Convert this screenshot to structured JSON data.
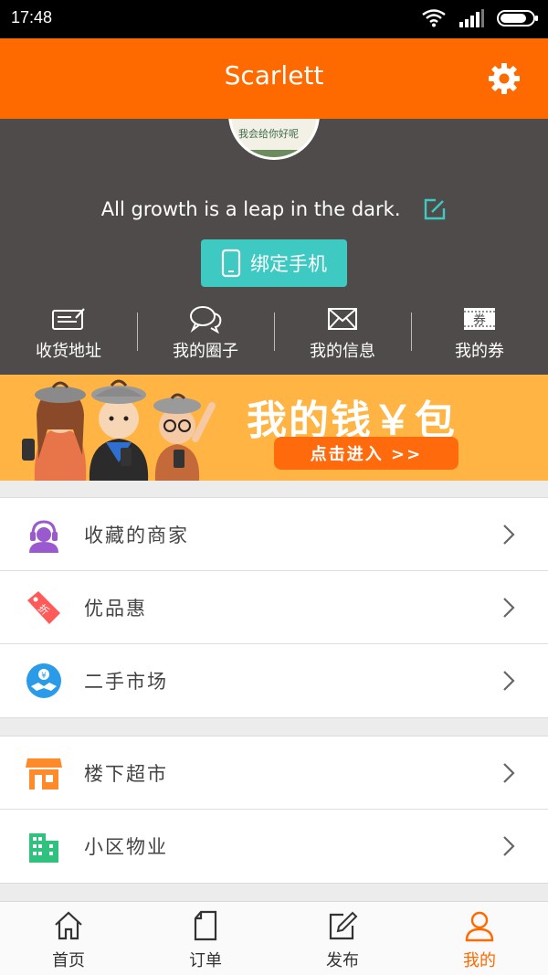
{
  "status_bar": {
    "time": "17:48"
  },
  "header": {
    "title": "Scarlett"
  },
  "profile": {
    "avatar_scribble": "我会给你好呢",
    "motto": "All growth is a leap in the dark.",
    "bind_phone_label": "绑定手机",
    "quick_links": [
      {
        "label": "收货地址",
        "icon": "address-card-icon"
      },
      {
        "label": "我的圈子",
        "icon": "chat-bubbles-icon"
      },
      {
        "label": "我的信息",
        "icon": "envelope-icon"
      },
      {
        "label": "我的券",
        "icon": "coupon-icon"
      }
    ],
    "coupon_icon_text": "券"
  },
  "wallet_banner": {
    "title": "我的钱￥包",
    "button_label": "点击进入 >>"
  },
  "menu_groups": [
    [
      {
        "label": "收藏的商家",
        "icon": "customer-service-icon",
        "color": "#9b59d0"
      },
      {
        "label": "优品惠",
        "icon": "discount-tag-icon",
        "color": "#ff5a5a"
      },
      {
        "label": "二手市场",
        "icon": "handshake-icon",
        "color": "#2a9be8"
      }
    ],
    [
      {
        "label": "楼下超市",
        "icon": "store-icon",
        "color": "#ff8a2a"
      },
      {
        "label": "小区物业",
        "icon": "building-icon",
        "color": "#2ec27e"
      }
    ]
  ],
  "discount_icon_text": "折",
  "handshake_icon_text": "¥",
  "tabs": [
    {
      "label": "首页",
      "icon": "home-icon",
      "active": false
    },
    {
      "label": "订单",
      "icon": "document-icon",
      "active": false
    },
    {
      "label": "发布",
      "icon": "compose-icon",
      "active": false
    },
    {
      "label": "我的",
      "icon": "profile-icon",
      "active": true
    }
  ],
  "colors": {
    "accent": "#ff6a00",
    "teal": "#3fc9c3",
    "profile_bg": "#4f4b4a",
    "banner": "#ffb443"
  }
}
